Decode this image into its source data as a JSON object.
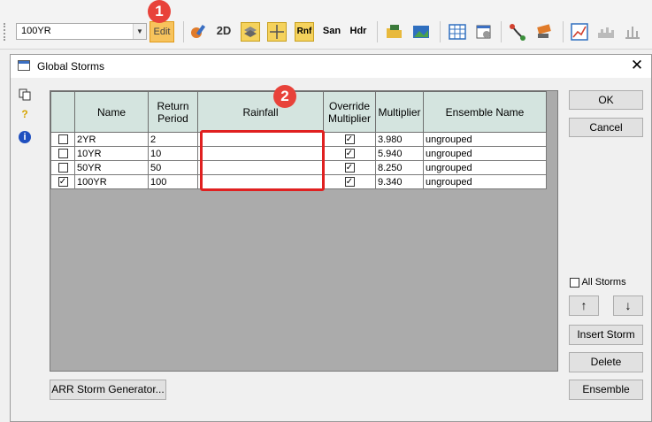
{
  "toolbar": {
    "storm_selected": "100YR",
    "edit_label": "Edit",
    "rnf_label": "Rnf",
    "san_label": "San",
    "hdr_label": "Hdr",
    "icon_2d_label": "2D"
  },
  "badges": {
    "one": "1",
    "two": "2"
  },
  "dialog": {
    "title": "Global Storms",
    "columns": {
      "name": "Name",
      "return_period": "Return Period",
      "rainfall": "Rainfall",
      "override": "Override Multiplier",
      "multiplier": "Multiplier",
      "ensemble": "Ensemble Name"
    },
    "rows": [
      {
        "checked": false,
        "name": "2YR",
        "return_period": "2",
        "rainfall": "",
        "override": true,
        "multiplier": "3.980",
        "ensemble": "ungrouped"
      },
      {
        "checked": false,
        "name": "10YR",
        "return_period": "10",
        "rainfall": "",
        "override": true,
        "multiplier": "5.940",
        "ensemble": "ungrouped"
      },
      {
        "checked": false,
        "name": "50YR",
        "return_period": "50",
        "rainfall": "",
        "override": true,
        "multiplier": "8.250",
        "ensemble": "ungrouped"
      },
      {
        "checked": true,
        "name": "100YR",
        "return_period": "100",
        "rainfall": "",
        "override": true,
        "multiplier": "9.340",
        "ensemble": "ungrouped"
      }
    ],
    "buttons": {
      "ok": "OK",
      "cancel": "Cancel",
      "all_storms": "All Storms",
      "insert_storm": "Insert Storm",
      "delete": "Delete",
      "ensemble": "Ensemble",
      "arr_generator": "ARR Storm Generator..."
    },
    "up_arrow": "↑",
    "down_arrow": "↓",
    "help_glyph": "?",
    "info_glyph": "i"
  }
}
